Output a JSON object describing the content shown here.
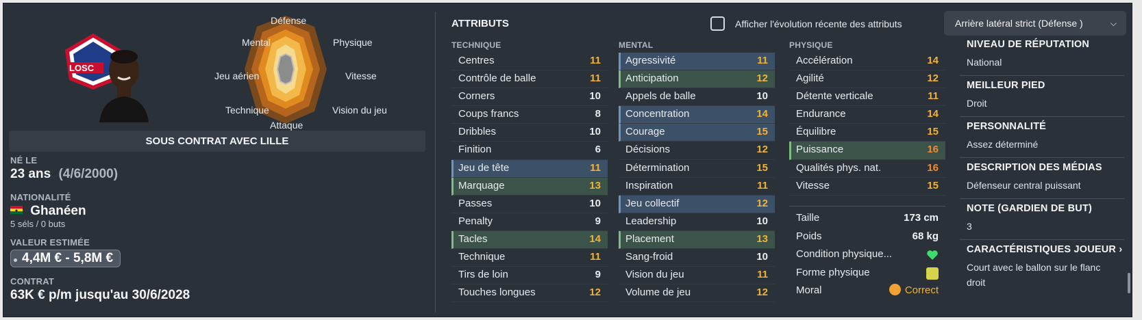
{
  "colors": {
    "background": "#2b3139",
    "highlight_blue": "#3c5068",
    "highlight_green": "#3c5349",
    "value_yellow": "#f2b233",
    "value_orange": "#ee8d2e",
    "radar_outer": "#7a4a1d",
    "radar_inner": "#f5d98a"
  },
  "club_logo": {
    "text": "LOSC"
  },
  "radar": {
    "labels": [
      "Défense",
      "Physique",
      "Vitesse",
      "Vision du jeu",
      "Attaque",
      "Technique",
      "Jeu aérien",
      "Mental"
    ]
  },
  "contract_bar": "SOUS CONTRAT AVEC LILLE",
  "birth": {
    "label": "NÉ LE",
    "age": "23 ans",
    "date": "(4/6/2000)"
  },
  "nationality": {
    "label": "NATIONALITÉ",
    "value": "Ghanéen",
    "caps": "5 séls / 0 buts",
    "flag_icon": "ghana-flag-icon"
  },
  "estimated_value": {
    "label": "VALEUR ESTIMÉE",
    "value": "4,4M € - 5,8M €"
  },
  "contract": {
    "label": "CONTRAT",
    "value": "63K € p/m jusqu'au 30/6/2028"
  },
  "attributes_title": "ATTRIBUTS",
  "evolution_toggle": {
    "label": "Afficher l'évolution récente des attributs",
    "checked": false
  },
  "role_select": {
    "value": "Arrière latéral strict (Défense )",
    "icon": "chevron-down-icon"
  },
  "technical": {
    "header": "TECHNIQUE",
    "rows": [
      {
        "name": "Centres",
        "value": "11"
      },
      {
        "name": "Contrôle de balle",
        "value": "11"
      },
      {
        "name": "Corners",
        "value": "10"
      },
      {
        "name": "Coups francs",
        "value": "8"
      },
      {
        "name": "Dribbles",
        "value": "10"
      },
      {
        "name": "Finition",
        "value": "6"
      },
      {
        "name": "Jeu de tête",
        "value": "11"
      },
      {
        "name": "Marquage",
        "value": "13"
      },
      {
        "name": "Passes",
        "value": "10"
      },
      {
        "name": "Penalty",
        "value": "9"
      },
      {
        "name": "Tacles",
        "value": "14"
      },
      {
        "name": "Technique",
        "value": "11"
      },
      {
        "name": "Tirs de loin",
        "value": "9"
      },
      {
        "name": "Touches longues",
        "value": "12"
      }
    ]
  },
  "mental": {
    "header": "MENTAL",
    "rows": [
      {
        "name": "Agressivité",
        "value": "11"
      },
      {
        "name": "Anticipation",
        "value": "12"
      },
      {
        "name": "Appels de balle",
        "value": "10"
      },
      {
        "name": "Concentration",
        "value": "14"
      },
      {
        "name": "Courage",
        "value": "15"
      },
      {
        "name": "Décisions",
        "value": "12"
      },
      {
        "name": "Détermination",
        "value": "15"
      },
      {
        "name": "Inspiration",
        "value": "11"
      },
      {
        "name": "Jeu collectif",
        "value": "12"
      },
      {
        "name": "Leadership",
        "value": "10"
      },
      {
        "name": "Placement",
        "value": "13"
      },
      {
        "name": "Sang-froid",
        "value": "10"
      },
      {
        "name": "Vision du jeu",
        "value": "11"
      },
      {
        "name": "Volume de jeu",
        "value": "12"
      }
    ]
  },
  "physical": {
    "header": "PHYSIQUE",
    "rows": [
      {
        "name": "Accélération",
        "value": "14"
      },
      {
        "name": "Agilité",
        "value": "12"
      },
      {
        "name": "Détente verticale",
        "value": "11"
      },
      {
        "name": "Endurance",
        "value": "14"
      },
      {
        "name": "Équilibre",
        "value": "15"
      },
      {
        "name": "Puissance",
        "value": "16"
      },
      {
        "name": "Qualités phys. nat.",
        "value": "16"
      },
      {
        "name": "Vitesse",
        "value": "15"
      }
    ]
  },
  "physical_stats": {
    "height_label": "Taille",
    "height": "173 cm",
    "weight_label": "Poids",
    "weight": "68 kg",
    "condition_label": "Condition physique...",
    "condition_icon": "heart-icon",
    "form_label": "Forme physique",
    "form_icon": "form-icon",
    "morale_label": "Moral",
    "morale": "Correct",
    "morale_icon": "morale-icon"
  },
  "right_panel": {
    "reputation_label": "NIVEAU DE RÉPUTATION",
    "reputation": "National",
    "foot_label": "MEILLEUR PIED",
    "foot": "Droit",
    "personality_label": "PERSONNALITÉ",
    "personality": "Assez déterminé",
    "media_label": "DESCRIPTION DES MÉDIAS",
    "media": "Défenseur central puissant",
    "gk_label": "NOTE (GARDIEN DE BUT)",
    "gk": "3",
    "traits_label": "CARACTÉRISTIQUES JOUEUR",
    "traits": "Court avec le ballon sur le flanc droit"
  }
}
